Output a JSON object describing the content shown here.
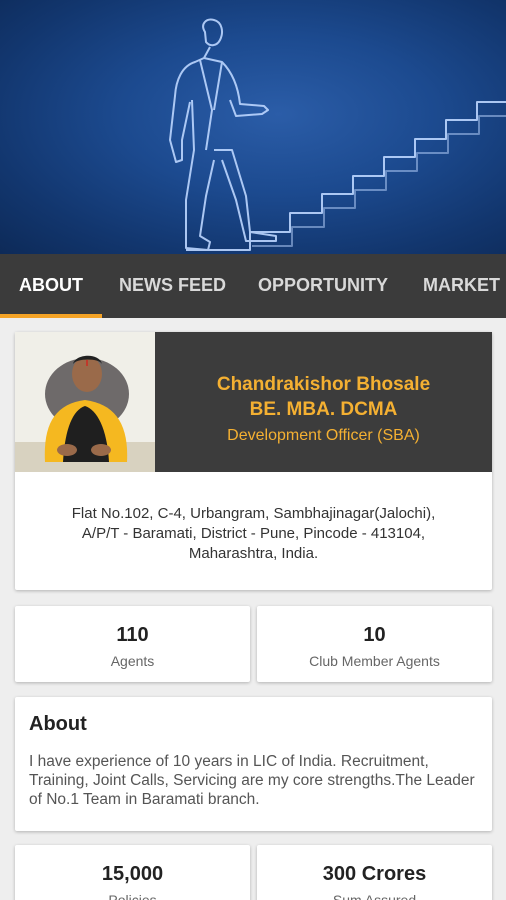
{
  "hero": {
    "illustration": "man-climbing-stairs-sketch"
  },
  "tabs": [
    {
      "label": "ABOUT",
      "active": true
    },
    {
      "label": "NEWS FEED",
      "active": false
    },
    {
      "label": "OPPORTUNITY",
      "active": false
    },
    {
      "label": "MARKET",
      "active": false
    }
  ],
  "profile": {
    "name": "Chandrakishor Bhosale",
    "degree": "BE. MBA. DCMA",
    "designation": "Development Officer (SBA)",
    "address_lines": [
      "Flat No.102, C-4, Urbangram, Sambhajinagar(Jalochi),",
      "A/P/T - Baramati, District - Pune, Pincode - 413104,",
      "Maharashtra, India."
    ]
  },
  "stats_row1": [
    {
      "value": "110",
      "label": "Agents"
    },
    {
      "value": "10",
      "label": "Club Member Agents"
    }
  ],
  "about": {
    "title": "About",
    "text": "I have experience of 10 years in LIC of India. Recruitment, Training, Joint Calls, Servicing are my core strengths.The Leader of No.1 Team in Baramati branch."
  },
  "stats_row2": [
    {
      "value": "15,000",
      "label": "Policies"
    },
    {
      "value": "300 Crores",
      "label": "Sum Assured"
    }
  ],
  "colors": {
    "accent": "#f4a326",
    "name_text": "#f4b032",
    "tab_bar": "#3b3b3b",
    "hero_blue": "#1c4a8f"
  }
}
